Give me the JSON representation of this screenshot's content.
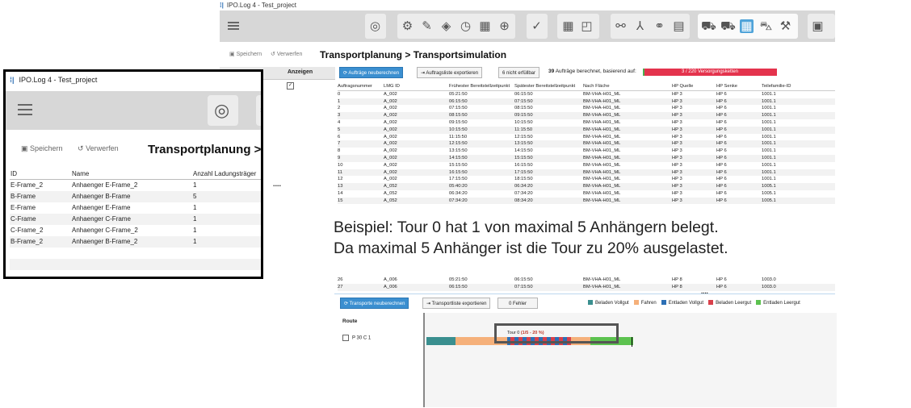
{
  "main_window": {
    "title": "IPO.Log 4 - Test_project",
    "save_label": "Speichern",
    "discard_label": "Verwerfen",
    "breadcrumb_1": "Transportplanung",
    "breadcrumb_sep": ">",
    "breadcrumb_2": "Transportsimulation",
    "left_header": "Anzeigen",
    "dots": "....",
    "recalc_orders_label": "Aufträge neuberechnen",
    "export_orders_label": "Auftragsliste exportieren",
    "not_fulfillable_label": "6 nicht erfüllbar",
    "orders_count": "39",
    "orders_text": "Aufträge berechnet, basierend auf:",
    "chains_label": "3 / 220 Versorgungsketten",
    "chains_fraction": 0.0136,
    "chains_bar_colors": {
      "done": "#4caf50",
      "remaining": "#e4334d"
    },
    "columns": [
      "Auftragsnummer",
      "LMG ID",
      "Frühester Bereitstellzeitpunkt",
      "Spätester Bereitstellzeitpunkt",
      "Nach Fläche",
      "HP Quelle",
      "HP Senke",
      "Teilefamilie-ID"
    ],
    "rows": [
      [
        "0",
        "A_002",
        "05:21:50",
        "06:15:50",
        "BM-VHA-H01_ML",
        "HP 3",
        "HP 6",
        "1001.1"
      ],
      [
        "1",
        "A_002",
        "06:15:50",
        "07:15:50",
        "BM-VHA-H01_ML",
        "HP 3",
        "HP 6",
        "1001.1"
      ],
      [
        "2",
        "A_002",
        "07:15:50",
        "08:15:50",
        "BM-VHA-H01_ML",
        "HP 3",
        "HP 6",
        "1001.1"
      ],
      [
        "3",
        "A_002",
        "08:15:50",
        "09:15:50",
        "BM-VHA-H01_ML",
        "HP 3",
        "HP 6",
        "1001.1"
      ],
      [
        "4",
        "A_002",
        "09:15:50",
        "10:15:50",
        "BM-VHA-H01_ML",
        "HP 3",
        "HP 6",
        "1001.1"
      ],
      [
        "5",
        "A_002",
        "10:15:50",
        "11:15:50",
        "BM-VHA-H01_ML",
        "HP 3",
        "HP 6",
        "1001.1"
      ],
      [
        "6",
        "A_002",
        "11:15:50",
        "12:15:50",
        "BM-VHA-H01_ML",
        "HP 3",
        "HP 6",
        "1001.1"
      ],
      [
        "7",
        "A_002",
        "12:15:50",
        "13:15:50",
        "BM-VHA-H01_ML",
        "HP 3",
        "HP 6",
        "1001.1"
      ],
      [
        "8",
        "A_002",
        "13:15:50",
        "14:15:50",
        "BM-VHA-H01_ML",
        "HP 3",
        "HP 6",
        "1001.1"
      ],
      [
        "9",
        "A_002",
        "14:15:50",
        "15:15:50",
        "BM-VHA-H01_ML",
        "HP 3",
        "HP 6",
        "1001.1"
      ],
      [
        "10",
        "A_002",
        "15:15:50",
        "16:15:50",
        "BM-VHA-H01_ML",
        "HP 3",
        "HP 6",
        "1001.1"
      ],
      [
        "11",
        "A_002",
        "16:15:50",
        "17:15:50",
        "BM-VHA-H01_ML",
        "HP 3",
        "HP 6",
        "1001.1"
      ],
      [
        "12",
        "A_002",
        "17:15:50",
        "18:15:50",
        "BM-VHA-H01_ML",
        "HP 3",
        "HP 6",
        "1001.1"
      ],
      [
        "13",
        "A_052",
        "05:40:20",
        "06:34:20",
        "BM-VHA-H01_ML",
        "HP 3",
        "HP 6",
        "1005.1"
      ],
      [
        "14",
        "A_052",
        "06:34:20",
        "07:34:20",
        "BM-VHA-H01_ML",
        "HP 3",
        "HP 6",
        "1005.1"
      ],
      [
        "15",
        "A_052",
        "07:34:20",
        "08:34:20",
        "BM-VHA-H01_ML",
        "HP 3",
        "HP 6",
        "1005.1"
      ]
    ]
  },
  "zoom_window": {
    "title": "IPO.Log 4 - Test_project",
    "save_label": "Speichern",
    "discard_label": "Verwerfen",
    "heading": "Transportplanung  >",
    "columns": [
      "ID",
      "Name",
      "Anzahl Ladungsträger"
    ],
    "rows": [
      [
        "E-Frame_2",
        "Anhaenger E-Frame_2",
        "1"
      ],
      [
        "B-Frame",
        "Anhaenger B-Frame",
        "5"
      ],
      [
        "E-Frame",
        "Anhaenger E-Frame",
        "1"
      ],
      [
        "C-Frame",
        "Anhaenger C-Frame",
        "1"
      ],
      [
        "C-Frame_2",
        "Anhaenger C-Frame_2",
        "1"
      ],
      [
        "B-Frame_2",
        "Anhaenger B-Frame_2",
        "1"
      ]
    ]
  },
  "caption": {
    "line1": "Beispiel: Tour 0 hat 1 von maximal 5 Anhängern belegt.",
    "line2": "Da maximal 5 Anhänger ist die Tour zu 20% ausgelastet."
  },
  "bottom_window": {
    "rows": [
      [
        "26",
        "A_006",
        "05:21:50",
        "06:15:50",
        "BM-VHA-H01_ML",
        "HP 8",
        "HP 6",
        "1003.0"
      ],
      [
        "27",
        "A_006",
        "06:15:50",
        "07:15:50",
        "BM-VHA-H01_ML",
        "HP 8",
        "HP 6",
        "1003.0"
      ]
    ],
    "dots": "....",
    "recalc_transports_label": "Transporte neuberechnen",
    "export_transports_label": "Transportliste exportieren",
    "errors_label": "0 Fehler",
    "legend": [
      {
        "label": "Beladen Vollgut",
        "color": "#3a8f8f"
      },
      {
        "label": "Fahren",
        "color": "#f5b07a"
      },
      {
        "label": "Entladen Vollgut",
        "color": "#2c6fb5"
      },
      {
        "label": "Beladen Leergut",
        "color": "#d9404a"
      },
      {
        "label": "Entladen Leergut",
        "color": "#5cc24f"
      }
    ],
    "route_header": "Route",
    "route_item": "P 30 C 1",
    "tour_label": "Tour 0",
    "tour_util": "(1/5 - 20 %)"
  }
}
